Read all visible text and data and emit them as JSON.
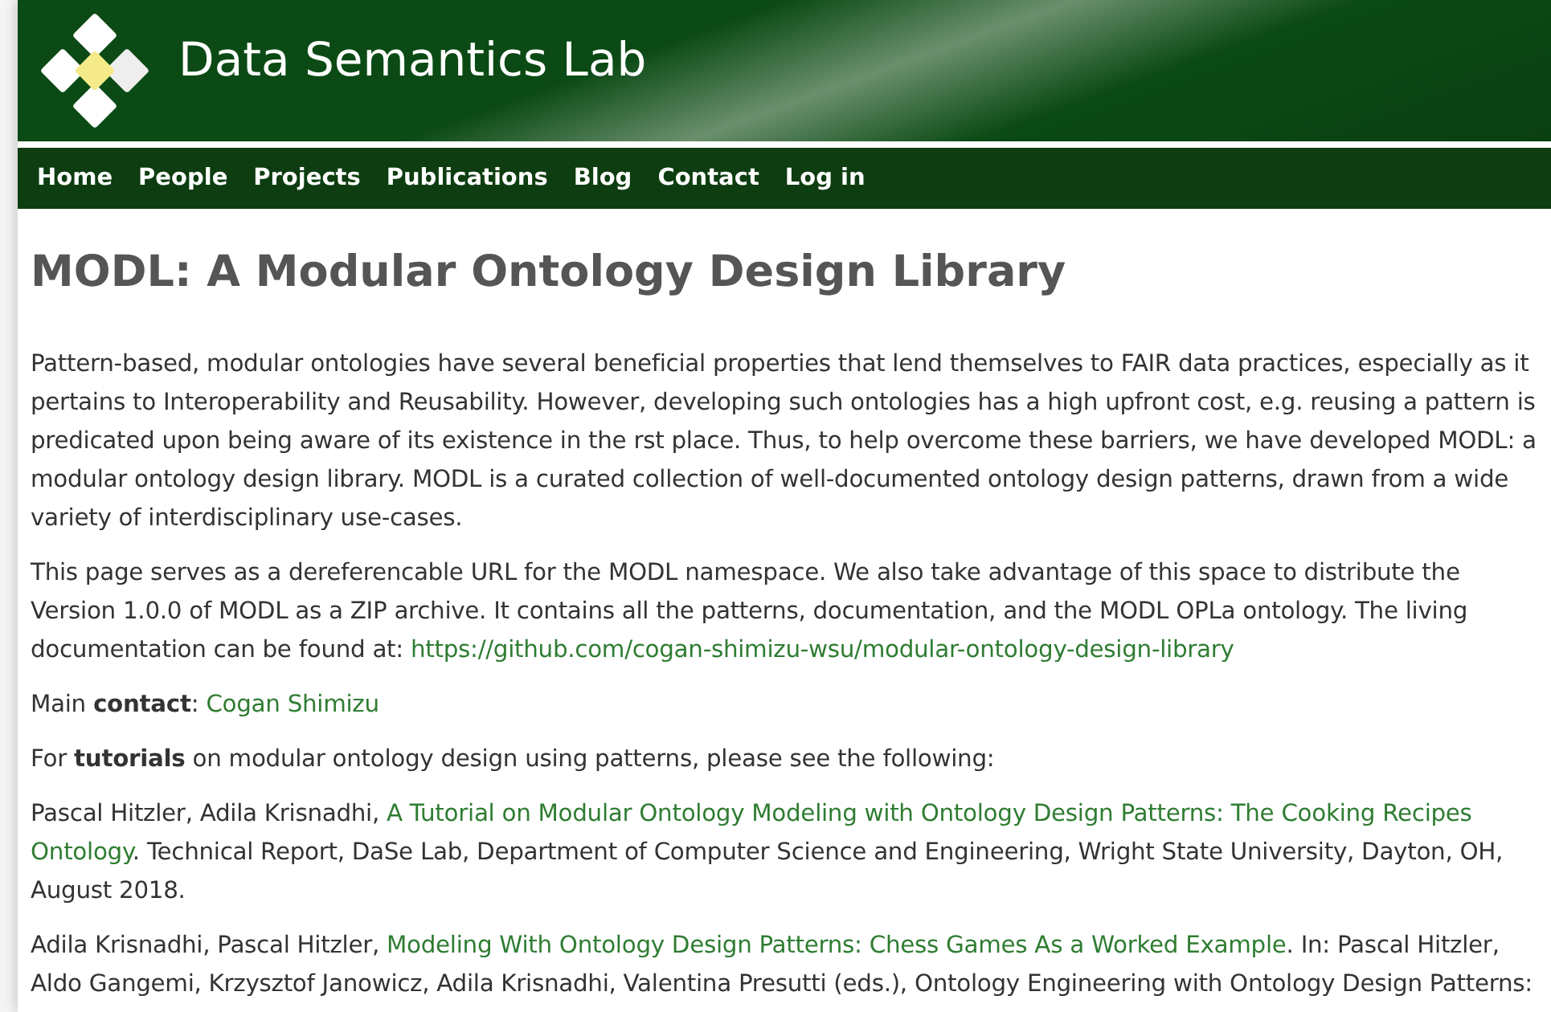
{
  "header": {
    "site_title": "Data Semantics Lab"
  },
  "nav": [
    "Home",
    "People",
    "Projects",
    "Publications",
    "Blog",
    "Contact",
    "Log in"
  ],
  "page_title": "MODL: A Modular Ontology Design Library",
  "paragraphs": [
    [
      {
        "kind": "text",
        "text": "Pattern-based, modular ontologies have several beneficial properties that lend themselves to FAIR data practices, especially as it pertains to Interoperability and Reusability. However, developing such ontologies has a high upfront cost, e.g. reusing a pattern is predicated upon being aware of its existence in the rst place. Thus, to help overcome these barriers, we have developed MODL: a modular ontology design library. MODL is a curated collection of well-documented ontology design patterns, drawn from a wide variety of interdisciplinary use-cases."
      }
    ],
    [
      {
        "kind": "text",
        "text": "This page serves as a dereferencable URL for the MODL namespace. We also take advantage of this space to distribute the Version 1.0.0 of MODL as a ZIP archive. It contains all the patterns, documentation, and the MODL OPLa ontology. The living documentation can be found at: "
      },
      {
        "kind": "link",
        "text": "https://github.com/cogan-shimizu-wsu/modular-ontology-design-library"
      }
    ],
    [
      {
        "kind": "text",
        "text": "Main "
      },
      {
        "kind": "bold",
        "text": "contact"
      },
      {
        "kind": "text",
        "text": ": "
      },
      {
        "kind": "link",
        "text": "Cogan Shimizu"
      }
    ],
    [
      {
        "kind": "text",
        "text": "For "
      },
      {
        "kind": "bold",
        "text": "tutorials"
      },
      {
        "kind": "text",
        "text": " on modular ontology design using patterns, please see the following:"
      }
    ],
    [
      {
        "kind": "text",
        "text": "Pascal Hitzler, Adila Krisnadhi, "
      },
      {
        "kind": "link",
        "text": "A Tutorial on Modular Ontology Modeling with Ontology Design Patterns: The Cooking Recipes"
      },
      {
        "kind": "link",
        "text": "Ontology"
      },
      {
        "kind": "text",
        "text": ". Technical Report, DaSe Lab, Department of Computer Science and Engineering, Wright State University, Dayton, OH, August 2018."
      }
    ],
    [
      {
        "kind": "text",
        "text": "Adila Krisnadhi, Pascal Hitzler, "
      },
      {
        "kind": "link",
        "text": "Modeling With Ontology Design Patterns: Chess Games As a Worked Example"
      },
      {
        "kind": "text",
        "text": ". In: Pascal Hitzler, Aldo Gangemi, Krzysztof Janowicz, Adila Krisnadhi, Valentina Presutti (eds.), Ontology Engineering with Ontology Design Patterns:"
      }
    ]
  ]
}
